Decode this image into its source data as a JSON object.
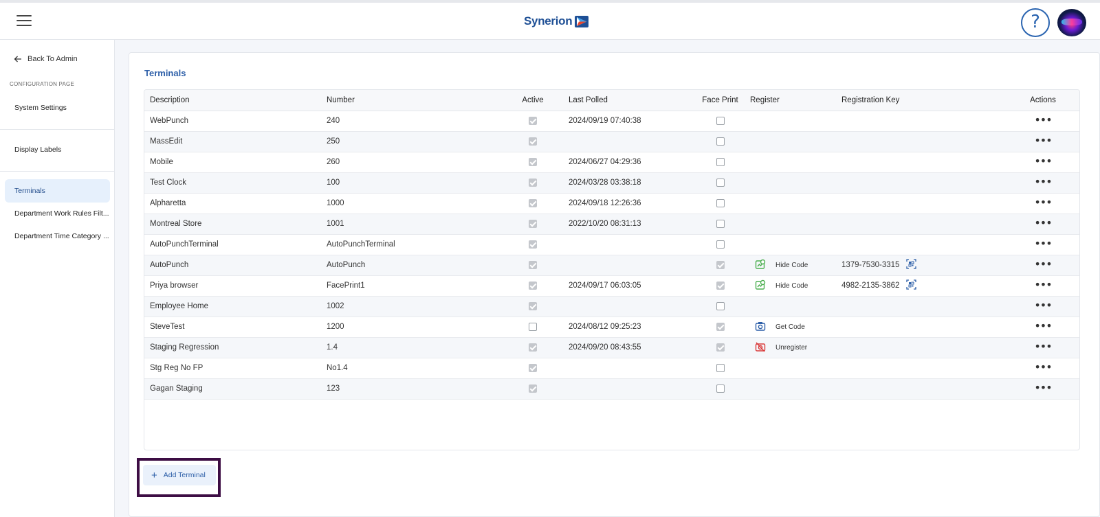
{
  "header": {
    "brand": "Synerion",
    "help_glyph": "?"
  },
  "sidebar": {
    "back_label": "Back To Admin",
    "section_label": "CONFIGURATION PAGE",
    "items": [
      {
        "label": "System Settings"
      },
      {
        "label": "Display Labels"
      },
      {
        "label": "Terminals",
        "active": true
      },
      {
        "label": "Department Work Rules Filt..."
      },
      {
        "label": "Department Time Category ..."
      }
    ]
  },
  "page": {
    "title": "Terminals"
  },
  "table": {
    "columns": [
      "Description",
      "Number",
      "Active",
      "Last Polled",
      "Face Print",
      "Register",
      "Registration Key",
      "Actions"
    ],
    "rows": [
      {
        "description": "WebPunch",
        "number": "240",
        "active": true,
        "last_polled": "2024/09/19 07:40:38",
        "face_print": false,
        "register": "",
        "register_icon": "",
        "key": ""
      },
      {
        "description": "MassEdit",
        "number": "250",
        "active": true,
        "last_polled": "",
        "face_print": false,
        "register": "",
        "register_icon": "",
        "key": ""
      },
      {
        "description": "Mobile",
        "number": "260",
        "active": true,
        "last_polled": "2024/06/27 04:29:36",
        "face_print": false,
        "register": "",
        "register_icon": "",
        "key": ""
      },
      {
        "description": "Test Clock",
        "number": "100",
        "active": true,
        "last_polled": "2024/03/28 03:38:18",
        "face_print": false,
        "register": "",
        "register_icon": "",
        "key": ""
      },
      {
        "description": "Alpharetta",
        "number": "1000",
        "active": true,
        "last_polled": "2024/09/18 12:26:36",
        "face_print": false,
        "register": "",
        "register_icon": "",
        "key": ""
      },
      {
        "description": "Montreal Store",
        "number": "1001",
        "active": true,
        "last_polled": "2022/10/20 08:31:13",
        "face_print": false,
        "register": "",
        "register_icon": "",
        "key": ""
      },
      {
        "description": "AutoPunchTerminal",
        "number": "AutoPunchTerminal",
        "active": true,
        "last_polled": "",
        "face_print": false,
        "register": "",
        "register_icon": "",
        "key": ""
      },
      {
        "description": "AutoPunch",
        "number": "AutoPunch",
        "active": true,
        "last_polled": "",
        "face_print": true,
        "register": "Hide Code",
        "register_icon": "hide-code",
        "key": "1379-7530-3315"
      },
      {
        "description": "Priya browser",
        "number": "FacePrint1",
        "active": true,
        "last_polled": "2024/09/17 06:03:05",
        "face_print": true,
        "register": "Hide Code",
        "register_icon": "hide-code",
        "key": "4982-2135-3862"
      },
      {
        "description": "Employee Home",
        "number": "1002",
        "active": true,
        "last_polled": "",
        "face_print": false,
        "register": "",
        "register_icon": "",
        "key": ""
      },
      {
        "description": "SteveTest",
        "number": "1200",
        "active": false,
        "last_polled": "2024/08/12 09:25:23",
        "face_print": true,
        "register": "Get Code",
        "register_icon": "get-code",
        "key": ""
      },
      {
        "description": "Staging Regression",
        "number": "1.4",
        "active": true,
        "last_polled": "2024/09/20 08:43:55",
        "face_print": true,
        "register": "Unregister",
        "register_icon": "unregister",
        "key": ""
      },
      {
        "description": "Stg Reg No FP",
        "number": "No1.4",
        "active": true,
        "last_polled": "",
        "face_print": false,
        "register": "",
        "register_icon": "",
        "key": ""
      },
      {
        "description": "Gagan Staging",
        "number": "123",
        "active": true,
        "last_polled": "",
        "face_print": false,
        "register": "",
        "register_icon": "",
        "key": ""
      }
    ],
    "actions_glyph": "•••"
  },
  "add_button": {
    "label": "Add Terminal",
    "plus": "+"
  },
  "colors": {
    "brand": "#1e4f95",
    "accent": "#2d5fa8",
    "register_green": "#4caf50",
    "unregister_red": "#d93b3b",
    "highlight": "#3d0d44"
  }
}
